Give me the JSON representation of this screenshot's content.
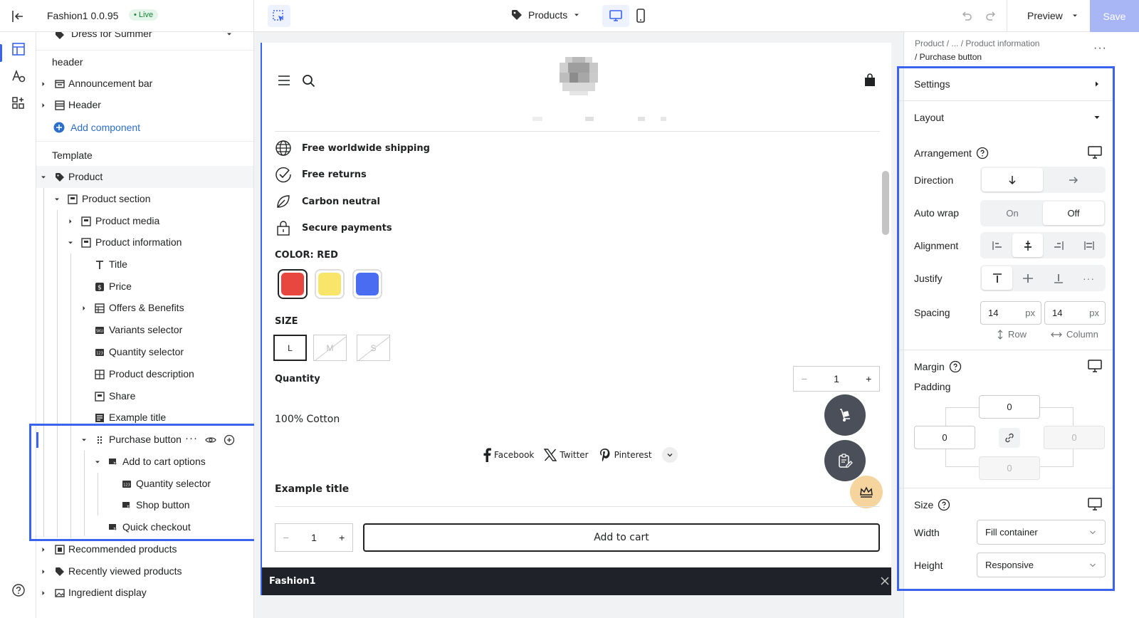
{
  "topbar": {
    "app_title": "Fashion1 0.0.95",
    "live_badge": "• Live",
    "page_selector": "Products",
    "preview_label": "Preview",
    "save_label": "Save"
  },
  "tree": {
    "top_item": "Dress for Summer",
    "header_section": "header",
    "announcement_bar": "Announcement bar",
    "header": "Header",
    "add_component": "Add component",
    "template_section": "Template",
    "product": "Product",
    "product_section": "Product section",
    "product_media": "Product media",
    "product_information": "Product information",
    "title": "Title",
    "price": "Price",
    "offers_benefits": "Offers & Benefits",
    "variants_selector": "Variants selector",
    "quantity_selector": "Quantity selector",
    "product_description": "Product description",
    "share": "Share",
    "example_title": "Example title",
    "purchase_button": "Purchase button",
    "add_to_cart_options": "Add to cart options",
    "quantity_selector_2": "Quantity selector",
    "shop_button": "Shop button",
    "quick_checkout": "Quick checkout",
    "recommended_products": "Recommended products",
    "recently_viewed_products": "Recently viewed products",
    "ingredient_display": "Ingredient display"
  },
  "preview": {
    "benefits": [
      "Free worldwide shipping",
      "Free returns",
      "Carbon neutral",
      "Secure payments"
    ],
    "color_label": "COLOR: RED",
    "colors": [
      "#e8473f",
      "#f8e56a",
      "#4a6cf0"
    ],
    "size_label": "SIZE",
    "sizes": [
      "L",
      "M",
      "S"
    ],
    "quantity_label": "Quantity",
    "quantity_value": "1",
    "material": "100% Cotton",
    "share": [
      "Facebook",
      "Twitter",
      "Pinterest"
    ],
    "example_title": "Example title",
    "atc_qty": "1",
    "add_to_cart": "Add to cart",
    "footer_brand": "Fashion1"
  },
  "right": {
    "crumb1": "Product / ... / Product information",
    "crumb2": "/ Purchase button",
    "settings": "Settings",
    "layout": "Layout",
    "arrangement": "Arrangement",
    "direction": "Direction",
    "auto_wrap": "Auto wrap",
    "auto_wrap_on": "On",
    "auto_wrap_off": "Off",
    "alignment": "Alignment",
    "justify": "Justify",
    "spacing": "Spacing",
    "spacing_row_value": "14",
    "spacing_col_value": "14",
    "unit": "px",
    "row_label": "Row",
    "column_label": "Column",
    "margin": "Margin",
    "padding": "Padding",
    "pad_top": "0",
    "pad_left": "0",
    "pad_right": "0",
    "pad_bottom": "0",
    "size": "Size",
    "width": "Width",
    "width_value": "Fill container",
    "height": "Height",
    "height_value": "Responsive"
  }
}
